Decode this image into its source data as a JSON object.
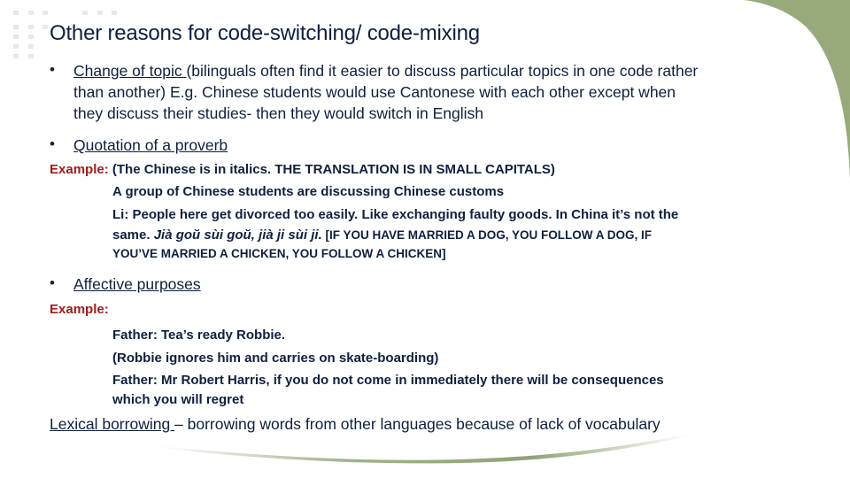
{
  "slide": {
    "title": "Other reasons for code-switching/ code-mixing",
    "colors": {
      "text": "#0f1f3f",
      "example_label": "#a01c1c",
      "accent_green": "#98aa7c",
      "deco_dots": "#e6e8ec"
    },
    "bullets": [
      {
        "heading": "Change of topic ",
        "lines": [
          "(bilinguals often find it easier to discuss particular topics in one code rather",
          "than another) E.g. Chinese students would use Cantonese with each other except when",
          "they discuss their studies- then they would switch in English"
        ]
      },
      {
        "heading": "Quotation of a proverb",
        "example_label": "Example:",
        "example_intro": " (The Chinese is in italics. THE TRANSLATION IS IN SMALL CAPITALS)",
        "example_lines": [
          "A group of Chinese students are discussing Chinese customs",
          "Li: People here get divorced too easily. Like exchanging faulty goods. In China it’s not the",
          "same. ",
          "Jià goŭ sùi goŭ, jià ji sùi ji.",
          " [IF YOU HAVE MARRIED A DOG, YOU FOLLOW A DOG, IF",
          "YOU’VE MARRIED A CHICKEN, YOU FOLLOW A CHICKEN]"
        ]
      },
      {
        "heading": "Affective purposes",
        "example_label": "Example:",
        "example_lines": [
          "Father: Tea’s ready Robbie.",
          "(Robbie ignores him and carries on skate-boarding)",
          "Father: Mr Robert Harris, if you do not come in immediately there will be consequences",
          "which you will regret"
        ]
      }
    ],
    "footer_item": {
      "heading": "Lexical borrowing ",
      "text": "– borrowing words from other languages because of lack of vocabulary"
    },
    "bullet_glyph": "•"
  }
}
